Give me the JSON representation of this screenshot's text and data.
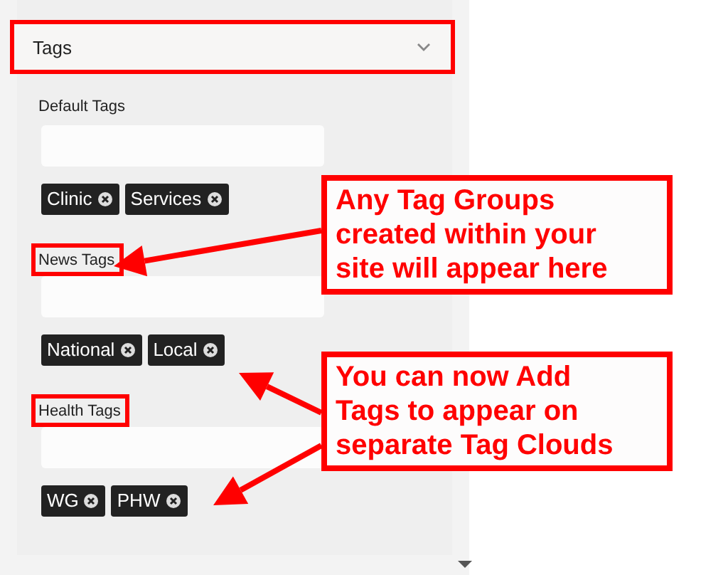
{
  "panel": {
    "title": "Tags",
    "highlighted": true
  },
  "groups": [
    {
      "label": "Default Tags",
      "highlighted": false,
      "tags": [
        "Clinic",
        "Services"
      ]
    },
    {
      "label": "News Tags",
      "highlighted": true,
      "tags": [
        "National",
        "Local"
      ]
    },
    {
      "label": "Health Tags",
      "highlighted": true,
      "tags": [
        "WG",
        "PHW"
      ]
    }
  ],
  "callouts": [
    {
      "text": "Any Tag Groups created within your site will appear here"
    },
    {
      "text": "You can now Add Tags to appear on separate Tag Clouds"
    }
  ]
}
